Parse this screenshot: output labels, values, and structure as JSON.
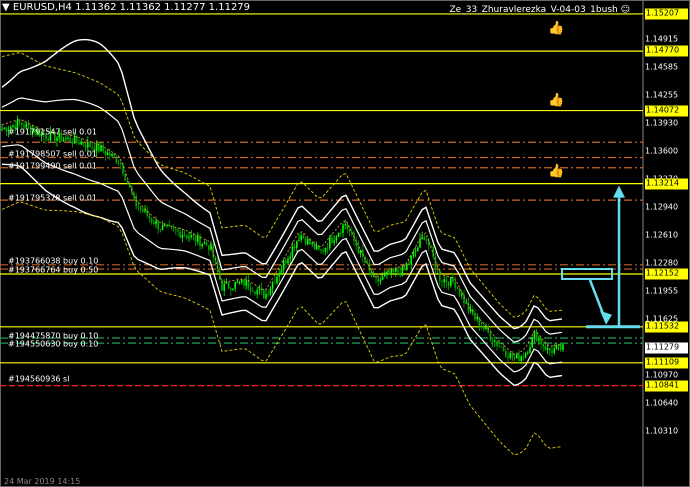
{
  "header": {
    "symbol_info": "EURUSD,H4  1.11362 1.11362 1.11277 1.11279",
    "expert_name": "Ze_33_Zhuravlerezka_V-04-03_1bush"
  },
  "price_axis": {
    "min": 1.0985,
    "max": 1.153,
    "ticks": [
      "1.14915",
      "1.14585",
      "1.14255",
      "1.13930",
      "1.13600",
      "1.13270",
      "1.12940",
      "1.12610",
      "1.12280",
      "1.11955",
      "1.11625",
      "1.10970",
      "1.10640",
      "1.10310"
    ],
    "boxes": [
      {
        "label": "1.15207",
        "value": 1.15207,
        "color": "#ffff00"
      },
      {
        "label": "1.14770",
        "value": 1.1477,
        "color": "#ffff00"
      },
      {
        "label": "1.14072",
        "value": 1.14072,
        "color": "#ffff00"
      },
      {
        "label": "1.13214",
        "value": 1.13214,
        "color": "#ffff00"
      },
      {
        "label": "1.12152",
        "value": 1.12152,
        "color": "#ffff00"
      },
      {
        "label": "1.11532",
        "value": 1.11532,
        "color": "#ffff00"
      },
      {
        "label": "1.11279",
        "value": 1.11279,
        "color": "#ffffff"
      },
      {
        "label": "1.11109",
        "value": 1.11109,
        "color": "#ffff00"
      },
      {
        "label": "1.10841",
        "value": 1.10841,
        "color": "#ffff00"
      }
    ]
  },
  "horizontal_levels": [
    {
      "value": 1.15207,
      "color": "#ffff00",
      "style": "solid"
    },
    {
      "value": 1.1477,
      "color": "#ffff00",
      "style": "solid"
    },
    {
      "value": 1.14072,
      "color": "#ffff00",
      "style": "solid"
    },
    {
      "value": 1.13214,
      "color": "#ffff00",
      "style": "solid"
    },
    {
      "value": 1.12152,
      "color": "#ffff00",
      "style": "solid"
    },
    {
      "value": 1.11532,
      "color": "#ffff00",
      "style": "solid"
    },
    {
      "value": 1.11109,
      "color": "#ffff00",
      "style": "solid"
    },
    {
      "value": 1.10841,
      "color": "#ff2020",
      "style": "dash"
    },
    {
      "value": 1.137,
      "color": "#c86428",
      "style": "dashdot"
    },
    {
      "value": 1.1352,
      "color": "#c86428",
      "style": "dashdot"
    },
    {
      "value": 1.134,
      "color": "#c86428",
      "style": "dashdot"
    },
    {
      "value": 1.1302,
      "color": "#c86428",
      "style": "dashdot"
    },
    {
      "value": 1.1226,
      "color": "#c86428",
      "style": "dashdot"
    },
    {
      "value": 1.1221,
      "color": "#c86428",
      "style": "dashdot"
    },
    {
      "value": 1.114,
      "color": "#1ea050",
      "style": "dashdot"
    },
    {
      "value": 1.1134,
      "color": "#1ea050",
      "style": "dashdot"
    }
  ],
  "orders": [
    {
      "label": "#191791547 sell 0.01",
      "value": 1.1382
    },
    {
      "label": "#191798507 sell 0.01",
      "value": 1.1356
    },
    {
      "label": "#191799490 sell 0.01",
      "value": 1.1342
    },
    {
      "label": "#191795378 sell 0.01",
      "value": 1.1304
    },
    {
      "label": "#193766038 buy 0.10",
      "value": 1.1231
    },
    {
      "label": "#193766764 buy 0.50",
      "value": 1.122
    },
    {
      "label": "#194475870 buy 0.10",
      "value": 1.1142
    },
    {
      "label": "#194550630 buy 0.10",
      "value": 1.1133
    },
    {
      "label": "#194560936 sl",
      "value": 1.1092
    }
  ],
  "thumbs": [
    {
      "icon": "thumbs-up-icon",
      "glyph": "👍",
      "value": 1.1502
    },
    {
      "icon": "thumbs-up-icon",
      "glyph": "👍",
      "value": 1.1417
    },
    {
      "icon": "thumbs-up-icon",
      "glyph": "👍",
      "value": 1.1334
    }
  ],
  "colors": {
    "background": "#000000",
    "bull_candle": "#00ff00",
    "bear_candle": "#00aa00",
    "bands": "#ffffff",
    "dotted_bands": "#e6d200",
    "arrow": "#66ddee"
  },
  "bottom_text": "24 Mar 2019 14:15"
}
